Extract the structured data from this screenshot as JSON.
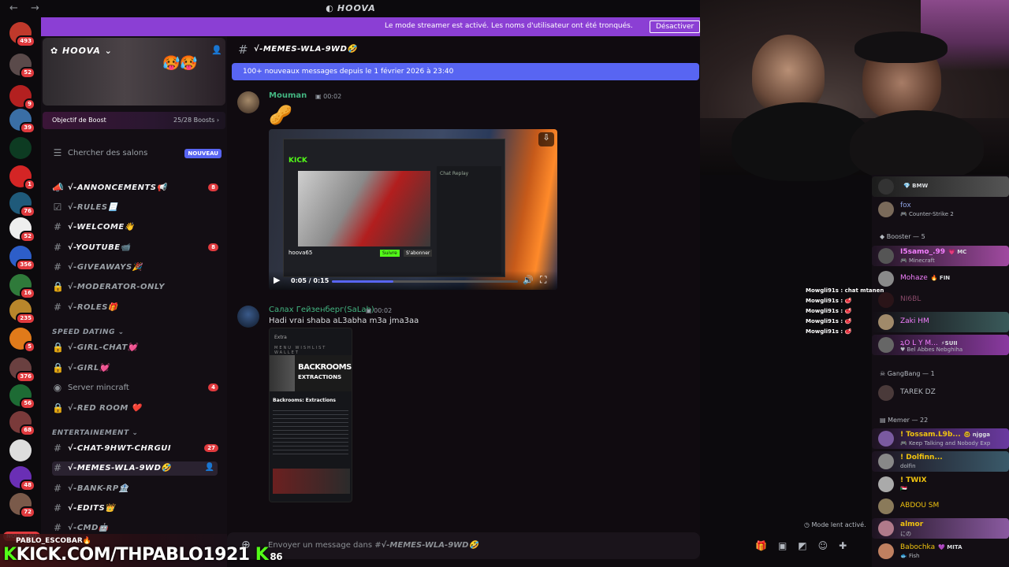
{
  "window": {
    "title": "HOOVA",
    "back": "←",
    "forward": "→"
  },
  "banner": {
    "message": "Le mode streamer est activé. Les noms d'utilisateur ont été tronqués.",
    "button": "Désactiver"
  },
  "rail": {
    "badges": [
      "493",
      "52",
      "9",
      "39",
      "1",
      "76",
      "52",
      "356",
      "16",
      "235",
      "5",
      "376",
      "56",
      "68",
      "48",
      "72"
    ],
    "new_label": "NOUVEAU"
  },
  "server": {
    "name": "HOOVA",
    "boost_goal": "Objectif de Boost",
    "boost_count": "25/28 Boosts"
  },
  "sidebar": {
    "search": {
      "label": "Chercher des salons",
      "badge": "NOUVEAU"
    },
    "channels": [
      {
        "name": "√-ANNONCEMENTS📢",
        "count": "8"
      },
      {
        "name": "√-RULES📃"
      },
      {
        "name": "√-WELCOME👋"
      },
      {
        "name": "√-YOUTUBE📹",
        "count": "8"
      },
      {
        "name": "√-GIVEAWAYS🎉"
      },
      {
        "name": "√-MODERATOR-ONLY"
      },
      {
        "name": "√-ROLES🎁"
      }
    ],
    "cat_speed": "SPEED DATING",
    "speed": [
      {
        "name": "√-GIRL-CHAT💓"
      },
      {
        "name": "√-GIRL💓"
      },
      {
        "name": "Server mincraft",
        "count": "4"
      },
      {
        "name": "√-RED ROOM ❤️"
      }
    ],
    "cat_ent": "ENTERTAINEMENT",
    "ent": [
      {
        "name": "√-CHAT-9HWT-CHRGUI",
        "count": "27"
      },
      {
        "name": "√-MEMES-WLA-9WD🤣"
      },
      {
        "name": "√-BANK-RP🏦"
      },
      {
        "name": "√-EDITS👑"
      },
      {
        "name": "√-CMD🤖"
      }
    ]
  },
  "channel": {
    "name": "√-MEMES-WLA-9WD🤣",
    "new_messages": "100+ nouveaux messages depuis le 1 février 2026 à 23:40"
  },
  "messages": [
    {
      "author": "Mouman",
      "time": "00:02",
      "emoji": "🥜"
    },
    {
      "author": "Салах Гейзенберг(SaLah)",
      "time": "00:02",
      "text": "Hadi vrai shaba aL3abha m3a jma3aa"
    }
  ],
  "video": {
    "time": "0:05 / 0:15",
    "progress": 0.33,
    "kick": "KICK",
    "chat_title": "Chat Replay",
    "follow": "Suivre",
    "sub": "S'abonner",
    "channel": "hoova65"
  },
  "phone": {
    "search": "Extra",
    "title1": "BACKROOMS",
    "title2": "EXTRACTIONS",
    "game": "Backrooms: Extractions",
    "tabs": [
      "MENU",
      "WISHLIST",
      "WALLET"
    ]
  },
  "composer": {
    "prefix": "Envoyer un message dans #",
    "channel": "√-MEMES-WLA-9WD🤣"
  },
  "members": {
    "top": [
      {
        "tag": "💎 BMW"
      },
      {
        "name": "fox",
        "sub": "🎮 Counter-Strike 2"
      }
    ],
    "booster_label": "Booster — 5",
    "booster": [
      {
        "name": "I5samo_.99",
        "sub": "🎮 Minecraft",
        "tag": "💗 MC"
      },
      {
        "name": "Mohaze",
        "tag": "🔥 FIN"
      },
      {
        "name": "NI6BL"
      },
      {
        "name": "Zaki HM"
      },
      {
        "name": "ꝝO L Y M...",
        "sub": "♥ Bel Abbes Nebghiha",
        "tag": "⚡SUII"
      }
    ],
    "gang_label": "GangBang — 1",
    "gang": [
      {
        "name": "TAREK DZ"
      }
    ],
    "memer_label": "Memer — 22",
    "memer": [
      {
        "name": "! Tossam.L9b...",
        "sub": "🎮 Keep Talking and Nobody Exp",
        "tag": "🤓 njgga"
      },
      {
        "name": "! Dolfinn...",
        "sub": "dolfin"
      },
      {
        "name": "! TWIX",
        "sub": "🇸🇩"
      },
      {
        "name": "ABDOU SM"
      },
      {
        "name": "almor",
        "sub": "にの"
      },
      {
        "name": "Babochka",
        "sub": "🐟 Fish",
        "tag": "💜 MITA"
      }
    ]
  },
  "stream_chat": [
    {
      "user": "Mowgli91s",
      "text": "chat mtanen"
    },
    {
      "user": "Mowgli91s",
      "text": "🥩"
    },
    {
      "user": "Mowgli91s",
      "text": "🥩"
    },
    {
      "user": "Mowgli91s",
      "text": "🥩"
    },
    {
      "user": "Mowgli91s",
      "text": "🥩"
    }
  ],
  "slowmode": "Mode lent activé.",
  "user": {
    "name": "PABLO_ESCOBAR🔥",
    "overlay": "KICK.COM/THPABLO1921",
    "viewers": "86"
  },
  "colors": {
    "accent": "#8b3fd4",
    "blurple": "#5865f2",
    "kick": "#53fc18",
    "badge": "#e03a3e"
  }
}
